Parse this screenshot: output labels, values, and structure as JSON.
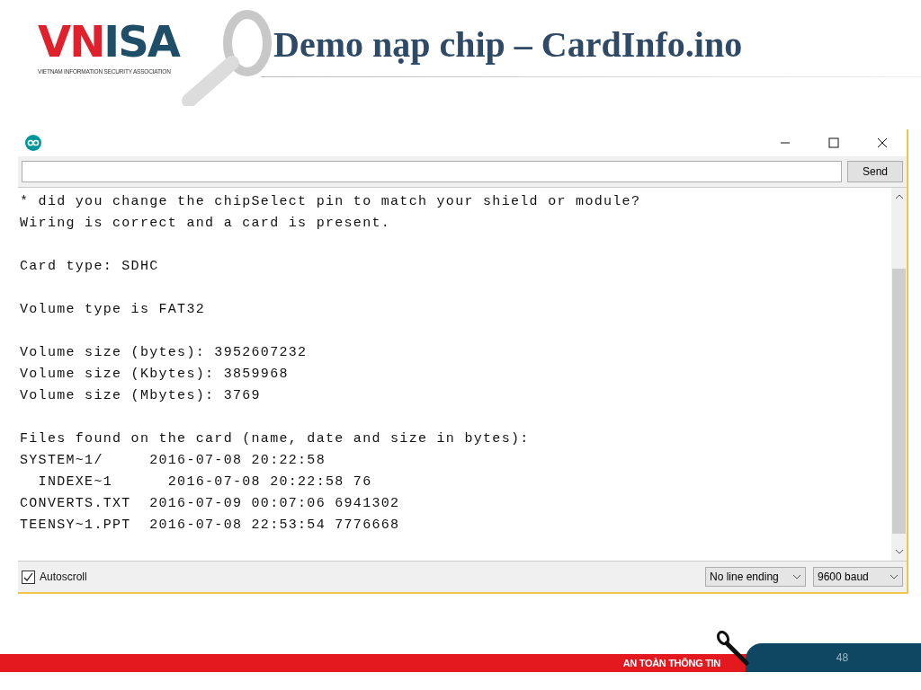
{
  "logo": {
    "name_parts": [
      {
        "text": "VN",
        "color": "#e0202a"
      },
      {
        "text": "ISA",
        "color": "#1f4e68"
      }
    ],
    "tagline": "VIETNAM INFORMATION SECURITY ASSOCIATION"
  },
  "slide_title": "Demo nạp chip – CardInfo.ino",
  "serial_monitor": {
    "send_button": "Send",
    "output_blocks": [
      [
        "* did you change the chipSelect pin to match your shield or module?",
        "Wiring is correct and a card is present."
      ],
      [
        "Card type: SDHC"
      ],
      [
        "Volume type is FAT32"
      ],
      [
        "Volume size (bytes): 3952607232",
        "Volume size (Kbytes): 3859968",
        "Volume size (Mbytes): 3769"
      ],
      [
        "Files found on the card (name, date and size in bytes):",
        "SYSTEM~1/     2016-07-08 20:22:58",
        "  INDEXE~1      2016-07-08 20:22:58 76",
        "CONVERTS.TXT  2016-07-09 00:07:06 6941302",
        "TEENSY~1.PPT  2016-07-08 22:53:54 7776668"
      ]
    ],
    "autoscroll": {
      "label": "Autoscroll",
      "checked": true
    },
    "line_ending": "No line ending",
    "baud": "9600 baud"
  },
  "footer": {
    "tagline": "AN TOÀN THÔNG TIN",
    "page_number": "48"
  }
}
